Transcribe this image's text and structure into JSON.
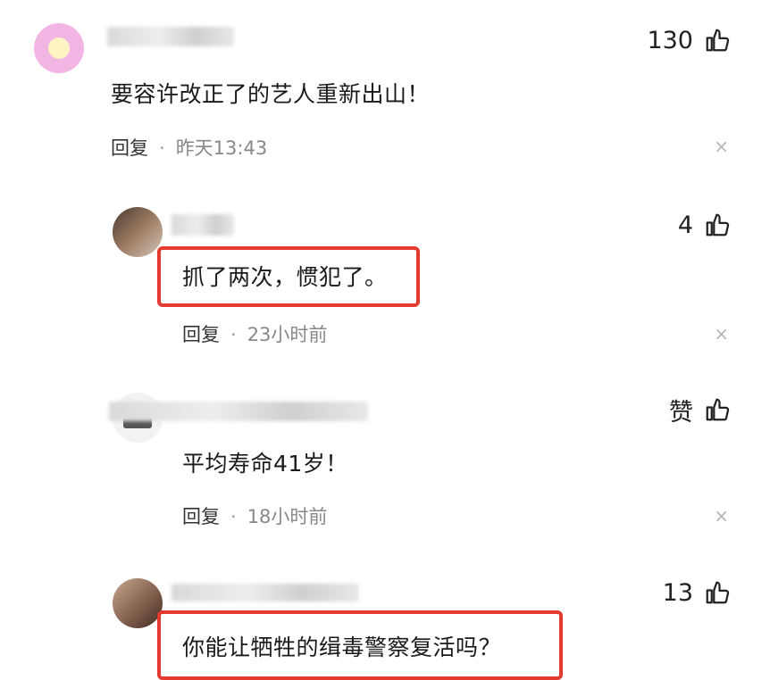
{
  "comments": [
    {
      "text": "要容许改正了的艺人重新出山！",
      "reply": "回复",
      "time": "昨天13:43",
      "likes": "130"
    },
    {
      "text": "抓了两次，惯犯了。",
      "reply": "回复",
      "time": "23小时前",
      "likes": "4"
    },
    {
      "text": "平均寿命41岁！",
      "reply": "回复",
      "time": "18小时前",
      "likes": "赞"
    },
    {
      "text": "你能让牺牲的缉毒警察复活吗？",
      "likes": "13"
    }
  ],
  "icons": {
    "like": "thumbs-up-icon",
    "close": "close-icon"
  },
  "colors": {
    "highlight": "#e23a2e",
    "meta": "#888888"
  },
  "close_glyph": "×",
  "dot": "·"
}
